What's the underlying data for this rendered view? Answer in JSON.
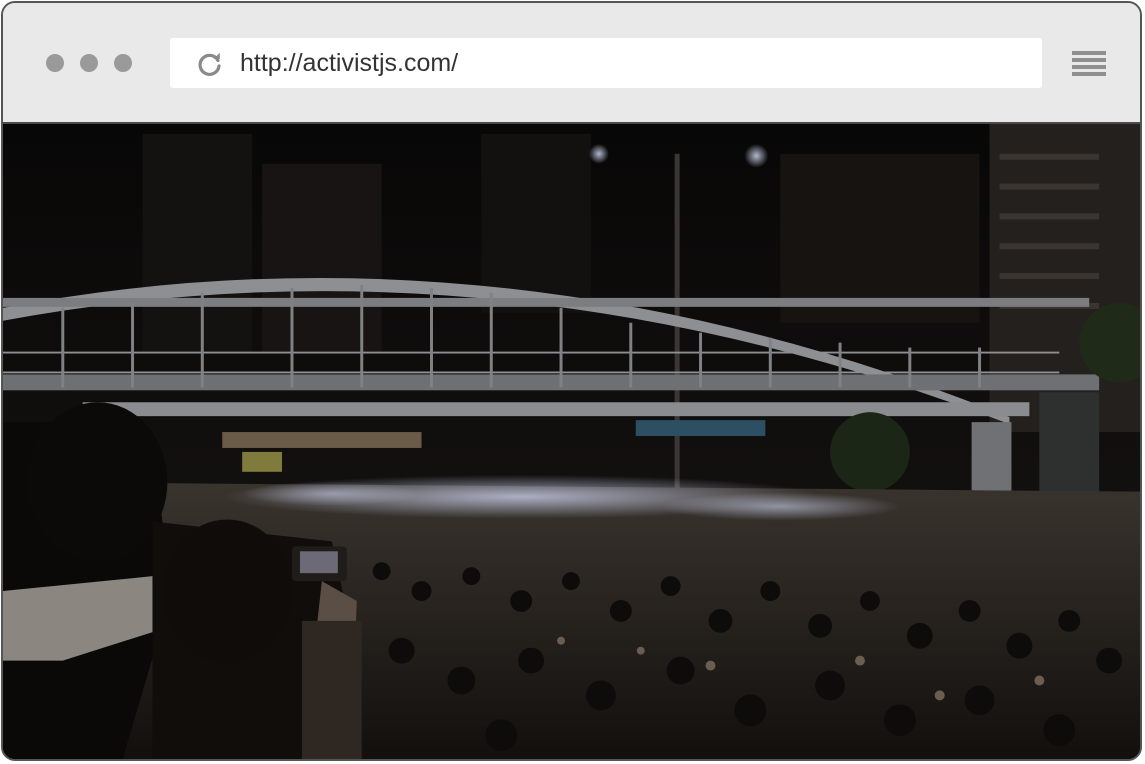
{
  "browser": {
    "url": "http://activistjs.com/",
    "icons": {
      "window_controls": "traffic-light-dots",
      "reload": "reload-icon",
      "menu": "hamburger-menu-icon"
    }
  },
  "hero_image": {
    "description_name": "night-crowd-photo",
    "accent_colors": {
      "sky": "#0c0b0b",
      "bridge": "#8d8f92",
      "phone_lights": "#d9e1ff"
    }
  }
}
